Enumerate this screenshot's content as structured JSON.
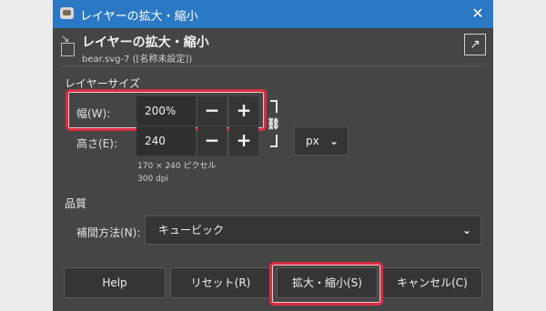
{
  "window": {
    "title": "レイヤーの拡大・縮小",
    "close_glyph": "✕"
  },
  "header": {
    "title": "レイヤーの拡大・縮小",
    "subtitle": "bear.svg-7 ([名称未設定])",
    "icon": "scale-layer-icon",
    "reset_icon": "open-arrow-icon"
  },
  "layer_size": {
    "section_label": "レイヤーサイズ",
    "width": {
      "label": "幅(W):",
      "value": "200%"
    },
    "height": {
      "label": "高さ(E):",
      "value": "240"
    },
    "minus_glyph": "−",
    "plus_glyph": "+",
    "chain_icon": "chain-link-icon",
    "unit": "px",
    "pixel_info": "170 × 240 ピクセル",
    "dpi_info": "300 dpi"
  },
  "quality": {
    "section_label": "品質",
    "interpolation": {
      "label": "補間方法(N):",
      "value": "キュービック"
    }
  },
  "buttons": {
    "help": "Help",
    "reset": "リセット(R)",
    "scale": "拡大・縮小(S)",
    "cancel": "キャンセル(C)"
  },
  "colors": {
    "highlight": "#d92d43",
    "titlebar": "#2b78c5",
    "dialog_bg": "#454545"
  }
}
